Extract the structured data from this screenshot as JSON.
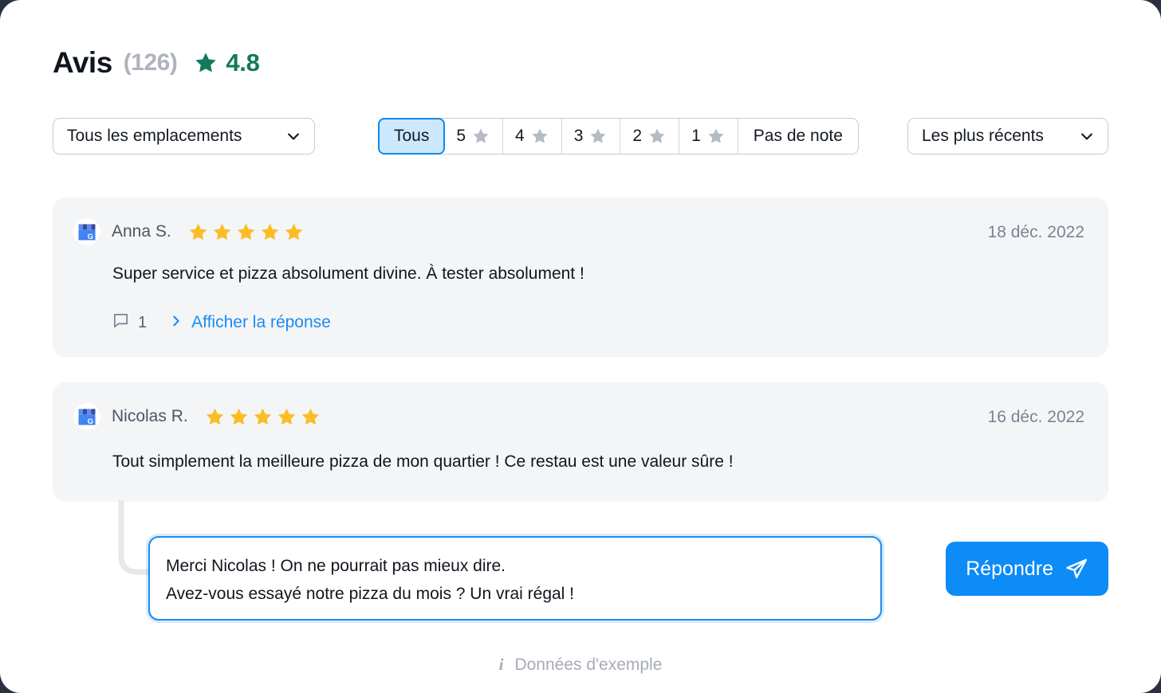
{
  "theme": {
    "page_background": "#2b3040",
    "card_background": "#ffffff",
    "review_card_background": "#f4f5f7",
    "accent_blue": "#1b8bf0",
    "button_blue": "#0d8bf7",
    "rating_green": "#12795e",
    "star_yellow": "#fbbc24",
    "star_gray": "#b6bcc6",
    "selected_segment_fill": "#cbe8fd"
  },
  "header": {
    "title": "Avis",
    "count": "(126)",
    "star_icon": "star-icon",
    "rating": "4.8"
  },
  "filters": {
    "locations": {
      "value": "Tous les emplacements",
      "chevron_icon": "chevron-down-icon"
    },
    "rating_segments": [
      {
        "label": "Tous",
        "has_star": false,
        "selected": true
      },
      {
        "label": "5",
        "has_star": true,
        "selected": false
      },
      {
        "label": "4",
        "has_star": true,
        "selected": false
      },
      {
        "label": "3",
        "has_star": true,
        "selected": false
      },
      {
        "label": "2",
        "has_star": true,
        "selected": false
      },
      {
        "label": "1",
        "has_star": true,
        "selected": false
      },
      {
        "label": "Pas de note",
        "has_star": false,
        "selected": false
      }
    ],
    "sort": {
      "value": "Les plus récents",
      "chevron_icon": "chevron-down-icon"
    }
  },
  "reviews": [
    {
      "avatar_icon": "google-business-profile-icon",
      "author": "Anna S.",
      "stars": 5,
      "date": "18 déc. 2022",
      "text": "Super service et pizza absolument divine. À tester absolument !",
      "comment_icon": "comment-bubble-icon",
      "comment_count": "1",
      "show_reply_chevron_icon": "chevron-right-icon",
      "show_reply_label": "Afficher la réponse"
    },
    {
      "avatar_icon": "google-business-profile-icon",
      "author": "Nicolas R.",
      "stars": 5,
      "date": "16 déc. 2022",
      "text": "Tout simplement la meilleure pizza de mon quartier ! Ce restau est une valeur sûre !"
    }
  ],
  "reply_composer": {
    "text": "Merci Nicolas ! On ne pourrait pas mieux dire.\nAvez-vous essayé notre pizza du mois ? Un vrai régal !",
    "placeholder": "Rédigez votre réponse…",
    "button_label": "Répondre",
    "button_icon": "send-paper-plane-icon",
    "focused": true
  },
  "footer": {
    "info_icon": "info-icon",
    "label": "Données d'exemple"
  }
}
